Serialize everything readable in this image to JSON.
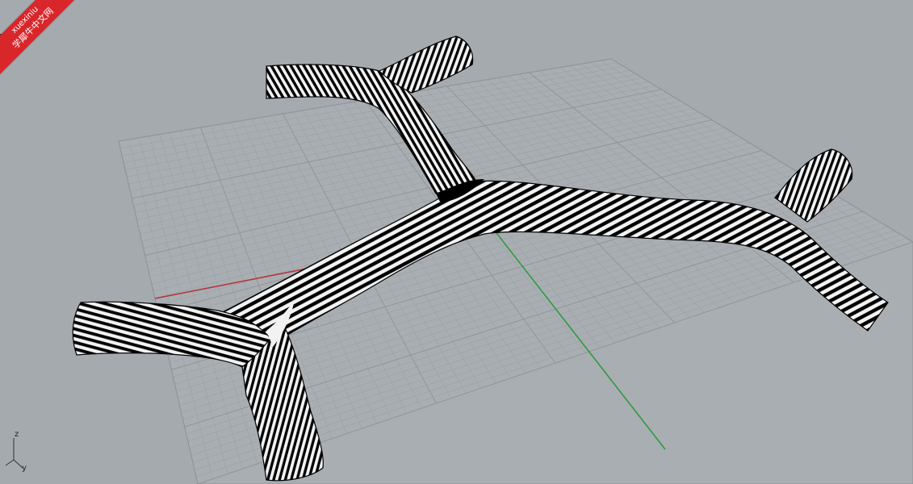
{
  "watermark": {
    "line1": "xuexiniu",
    "line2": "学犀牛中文网"
  },
  "axis_widget": {
    "z_label": "z",
    "y_label": "y"
  },
  "colors": {
    "background": "#a5aaaf",
    "grid_major": "#8f959a",
    "grid_minor": "#9ba0a5",
    "x_axis": "#b3363a",
    "y_axis": "#2e9a3d",
    "zebra_dark": "#000000",
    "zebra_light": "#f2f2f2",
    "watermark_red": "#d8262a"
  },
  "view": {
    "render_mode": "zebra analysis",
    "object": "branching tube surface"
  }
}
